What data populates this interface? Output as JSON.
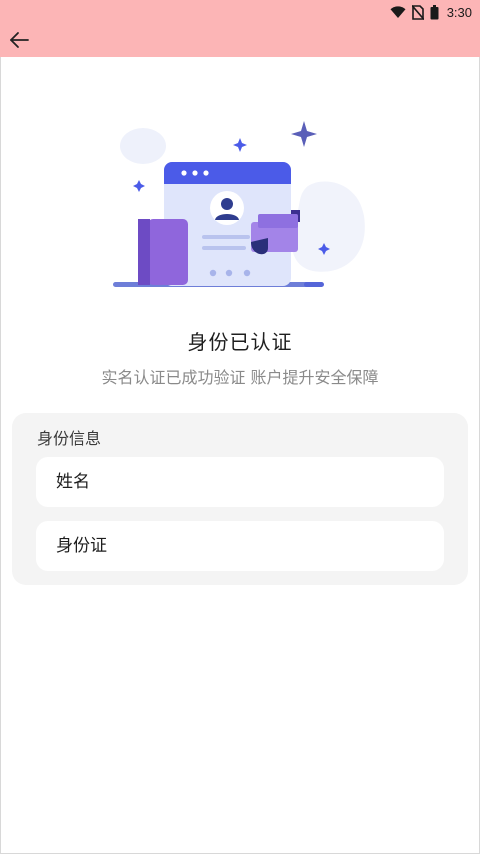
{
  "status_bar": {
    "time": "3:30",
    "icons": [
      "wifi-icon",
      "no-sim-icon",
      "battery-icon"
    ]
  },
  "app_bar": {
    "background_color": "#fcb5b6",
    "back_icon": "arrow-left-icon"
  },
  "illustration": {
    "icon": "identity-card-illustration",
    "accent_color": "#4b5be8",
    "secondary_color": "#8a63d8"
  },
  "verification": {
    "title": "身份已认证",
    "subtitle": "实名认证已成功验证 账户提升安全保障"
  },
  "identity_info": {
    "section_title": "身份信息",
    "fields": [
      {
        "label": "姓名"
      },
      {
        "label": "身份证"
      }
    ]
  }
}
